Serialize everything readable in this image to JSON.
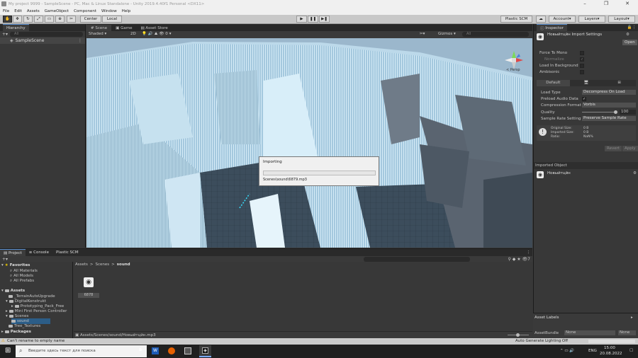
{
  "window": {
    "title": "My project 9999 - SampleScene - PC, Mac & Linux Standalone - Unity 2019.4.40f1 Personal <DX11>"
  },
  "menu": [
    "File",
    "Edit",
    "Assets",
    "GameObject",
    "Component",
    "Window",
    "Help"
  ],
  "toolbar": {
    "pivot": "Center",
    "space": "Local",
    "plastic": "Plastic SCM",
    "account": "Account",
    "layers": "Layers",
    "layout": "Layout"
  },
  "hierarchy": {
    "tab": "Hierarchy",
    "search_placeholder": "All",
    "scene": "SampleScene"
  },
  "scene": {
    "tabs": [
      "Scene",
      "Game",
      "Asset Store"
    ],
    "shading": "Shaded",
    "mode2d": "2D",
    "gizmos": "Gizmos",
    "search_placeholder": "All",
    "persp": "< Persp"
  },
  "dialog": {
    "title": "Importing",
    "file": "Scenes\\sound\\6879.mp3",
    "progress": 0
  },
  "inspector": {
    "tab": "Inspector",
    "asset_title": "Новыйтцйн Import Settings",
    "open": "Open",
    "force_mono": "Force To Mono",
    "normalize": "Normalize",
    "load_bg": "Load In Background",
    "ambisonic": "Ambisonic",
    "platform_default": "Default",
    "load_type": {
      "label": "Load Type",
      "value": "Decompress On Load"
    },
    "preload": {
      "label": "Preload Audio Data"
    },
    "compression": {
      "label": "Compression Format",
      "value": "Vorbis"
    },
    "quality": {
      "label": "Quality",
      "value": "100",
      "level": 1.0
    },
    "sample_rate": {
      "label": "Sample Rate Setting",
      "value": "Preserve Sample Rate"
    },
    "info": {
      "original": "Original Size:",
      "original_val": "0 B",
      "imported": "Imported Size:",
      "imported_val": "0 B",
      "ratio": "Ratio:",
      "ratio_val": "NaN%"
    },
    "revert": "Revert",
    "apply": "Apply",
    "imported_object": "Imported Object",
    "object_name": "Новыйтцйн"
  },
  "asset_labels": {
    "title": "Asset Labels",
    "bundle_label": "AssetBundle",
    "bundle_value": "None",
    "variant_value": "None"
  },
  "project": {
    "tabs": [
      "Project",
      "Console",
      "Plastic SCM"
    ],
    "breadcrumb": [
      "Assets",
      ">",
      "Scenes",
      ">",
      "sound"
    ],
    "favorites": {
      "label": "Favorites",
      "items": [
        "All Materials",
        "All Models",
        "All Prefabs"
      ]
    },
    "assets": {
      "label": "Assets",
      "items": [
        {
          "name": "_TerrainAutoUpgrade",
          "depth": 1
        },
        {
          "name": "DigitalKonstrukt",
          "depth": 1
        },
        {
          "name": "Prototyping_Pack_Free",
          "depth": 2
        },
        {
          "name": "Mini First Person Controller",
          "depth": 1
        },
        {
          "name": "Scenes",
          "depth": 1
        },
        {
          "name": "sound",
          "depth": 2
        },
        {
          "name": "Tree_Textures",
          "depth": 1
        }
      ]
    },
    "packages": "Packages",
    "file": "6878",
    "footer_path": "Assets/Scenes/sound/Новыйтцйн.mp3"
  },
  "status": {
    "message": "Can't rename to empty name",
    "lighting": "Auto Generate Lighting Off"
  },
  "taskbar": {
    "search": "Введите здесь текст для поиска",
    "lang": "ENG",
    "time": "15:00",
    "date": "20.08.2022"
  },
  "colors": {
    "unity_blue": "#3d7dd6",
    "warning": "#e8a000",
    "sky": "#a9d1e6"
  }
}
